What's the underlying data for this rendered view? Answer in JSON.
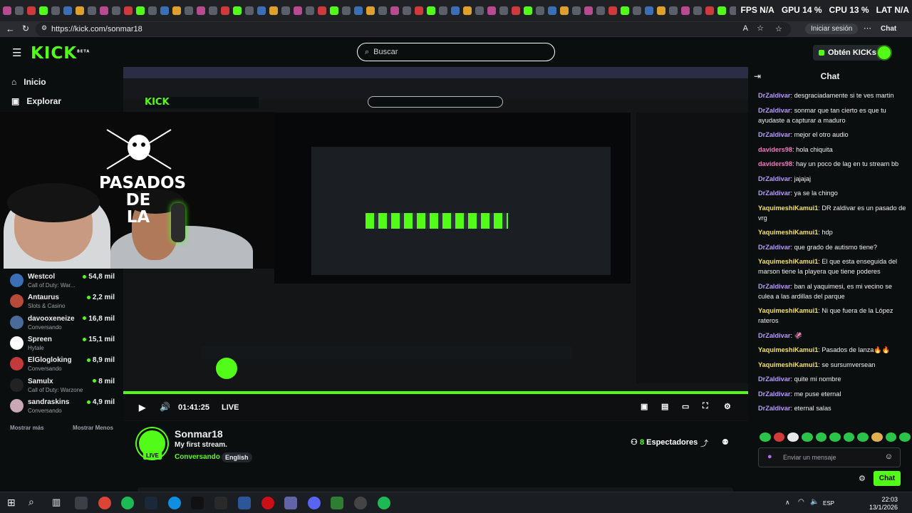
{
  "browser": {
    "url": "https://kick.com/sonmar18",
    "signin_label": "Iniciar sesión",
    "chat_tab_label": "Chat",
    "perf": {
      "fps": "FPS N/A",
      "gpu": "GPU 14 %",
      "cpu": "CPU 13 %",
      "lat": "LAT N/A"
    }
  },
  "header": {
    "logo": "KICK",
    "logo_sup": "BETA",
    "search_placeholder": "Buscar",
    "get_kicks_label": "Obtén KICKs"
  },
  "sidebar": {
    "nav": [
      {
        "label": "Inicio",
        "icon": "home-icon"
      },
      {
        "label": "Explorar",
        "icon": "compass-icon"
      }
    ],
    "channels": [
      {
        "name": "Westcol",
        "category": "Call of Duty: War...",
        "viewers": "54,8 mil",
        "color": "#3a6fb5"
      },
      {
        "name": "Antaurus",
        "category": "Slots & Casino",
        "viewers": "2,2 mil",
        "color": "#b84a3a"
      },
      {
        "name": "davooxeneize",
        "category": "Conversando",
        "viewers": "16,8 mil",
        "color": "#4a6a9a"
      },
      {
        "name": "Spreen",
        "category": "Hytale",
        "viewers": "15,1 mil",
        "color": "#ffffff"
      },
      {
        "name": "ElGlogloking",
        "category": "Conversando",
        "viewers": "8,9 mil",
        "color": "#c23a3a"
      },
      {
        "name": "Samulx",
        "category": "Call of Duty: Warzone",
        "viewers": "8 mil",
        "color": "#222222"
      },
      {
        "name": "sandraskins",
        "category": "Conversando",
        "viewers": "4,9 mil",
        "color": "#c9a7b5"
      }
    ],
    "show_more": "Mostrar más",
    "show_less": "Mostrar Menos"
  },
  "webcam": {
    "overlay_text_1": "PASADOS",
    "overlay_text_2": "DE",
    "overlay_text_3": "LA"
  },
  "player": {
    "time": "01:41:25",
    "live_label": "LIVE"
  },
  "stream": {
    "channel": "Sonmar18",
    "title": "My first stream.",
    "category": "Conversando",
    "language": "English",
    "live_badge": "LIVE",
    "viewer_count": "8",
    "viewers_label": "Espectadores"
  },
  "chat": {
    "header": "Chat",
    "messages": [
      {
        "user": "DrZaldivar",
        "color": "#b99bff",
        "text": "desgraciadamente si te ves martin"
      },
      {
        "user": "DrZaldivar",
        "color": "#b99bff",
        "text": "sonmar que tan cierto es que tu ayudaste a capturar a maduro"
      },
      {
        "user": "DrZaldivar",
        "color": "#b99bff",
        "text": "mejor el otro audio"
      },
      {
        "user": "daviders98",
        "color": "#f07ac0",
        "text": "hola chiquita"
      },
      {
        "user": "daviders98",
        "color": "#f07ac0",
        "text": "hay un poco de lag en tu stream bb"
      },
      {
        "user": "DrZaldivar",
        "color": "#b99bff",
        "text": "jajajaj"
      },
      {
        "user": "DrZaldivar",
        "color": "#b99bff",
        "text": "ya se la chingo"
      },
      {
        "user": "YaquimeshiKamui1",
        "color": "#f5e15a",
        "text": "DR zaldivar es un pasado de vrg"
      },
      {
        "user": "YaquimeshiKamui1",
        "color": "#f5e15a",
        "text": "hdp"
      },
      {
        "user": "DrZaldivar",
        "color": "#b99bff",
        "text": "que grado de autismo tiene?"
      },
      {
        "user": "YaquimeshiKamui1",
        "color": "#f5e15a",
        "text": "El que esta enseguida del marson tiene la playera que tiene poderes"
      },
      {
        "user": "DrZaldivar",
        "color": "#b99bff",
        "text": "ban al yaquimesi, es mi vecino se culea a las ardillas del parque"
      },
      {
        "user": "YaquimeshiKamui1",
        "color": "#f5e15a",
        "text": "Ni que fuera de la López rateros"
      },
      {
        "user": "DrZaldivar",
        "color": "#b99bff",
        "text": "🦑"
      },
      {
        "user": "YaquimeshiKamui1",
        "color": "#f5e15a",
        "text": "Pasados de lanza🔥🔥"
      },
      {
        "user": "YaquimeshiKamui1",
        "color": "#f5e15a",
        "text": "se sursumversean"
      },
      {
        "user": "DrZaldivar",
        "color": "#b99bff",
        "text": "quite mi nombre"
      },
      {
        "user": "DrZaldivar",
        "color": "#b99bff",
        "text": "me puse eternal"
      },
      {
        "user": "DrZaldivar",
        "color": "#b99bff",
        "text": "eternal salas"
      }
    ],
    "input_placeholder": "Enviar un mensaje",
    "send_label": "Chat"
  },
  "taskbar": {
    "time": "22:03",
    "date": "13/1/2026",
    "lang": "ESP"
  }
}
